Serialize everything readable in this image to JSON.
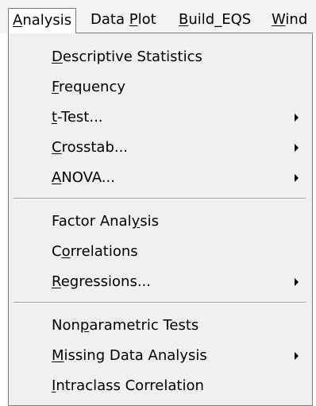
{
  "menubar": {
    "items": [
      {
        "label": "Analysis",
        "mnemonic": "A"
      },
      {
        "label": "Data Plot",
        "mnemonic": "P"
      },
      {
        "label": "Build_EQS",
        "mnemonic": "B"
      },
      {
        "label": "Wind",
        "mnemonic": "W"
      }
    ]
  },
  "analysis_menu": {
    "items": [
      {
        "label": "Descriptive Statistics",
        "mnemonic": "D",
        "submenu": false
      },
      {
        "label": "Frequency",
        "mnemonic": "F",
        "submenu": false
      },
      {
        "label": "t-Test...",
        "mnemonic": "t",
        "submenu": true
      },
      {
        "label": "Crosstab...",
        "mnemonic": "C",
        "submenu": true
      },
      {
        "label": "ANOVA...",
        "mnemonic": "A",
        "submenu": true
      },
      {
        "label": "Factor Analysis",
        "mnemonic": "y",
        "submenu": false
      },
      {
        "label": "Correlations",
        "mnemonic": "o",
        "submenu": false
      },
      {
        "label": "Regressions...",
        "mnemonic": "R",
        "submenu": true
      },
      {
        "label": "Nonparametric Tests",
        "mnemonic": "p",
        "submenu": false
      },
      {
        "label": "Missing Data Analysis",
        "mnemonic": "M",
        "submenu": true
      },
      {
        "label": "Intraclass Correlation",
        "mnemonic": "I",
        "submenu": false
      }
    ]
  }
}
